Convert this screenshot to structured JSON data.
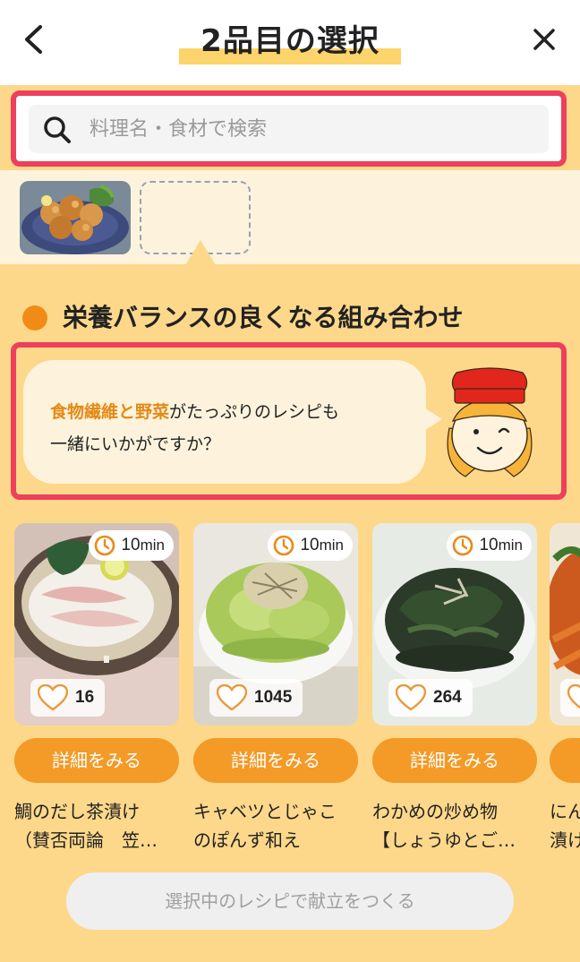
{
  "header": {
    "title": "2品目の選択",
    "back_icon": "chevron-left-icon",
    "close_icon": "close-icon"
  },
  "search": {
    "placeholder": "料理名・食材で検索",
    "value": "",
    "icon": "search-icon"
  },
  "selection": {
    "slots": [
      {
        "state": "filled",
        "image": "fried-chicken-photo"
      },
      {
        "state": "empty"
      }
    ]
  },
  "section": {
    "title": "栄養バランスの良くなる組み合わせ"
  },
  "advice": {
    "highlight1": "食物繊維",
    "connector": "と",
    "highlight2": "野菜",
    "rest_line1": "がたっぷりのレシピも",
    "line2": "一緒にいかがですか？"
  },
  "recipes": [
    {
      "time_value": "10",
      "time_unit": "min",
      "likes": "16",
      "detail_label": "詳細をみる",
      "name": "鯛のだし茶漬け\n（賛否両論　笠…"
    },
    {
      "time_value": "10",
      "time_unit": "min",
      "likes": "1045",
      "detail_label": "詳細をみる",
      "name": "キャベツとじゃこ\nのぽんず和え"
    },
    {
      "time_value": "10",
      "time_unit": "min",
      "likes": "264",
      "detail_label": "詳細をみる",
      "name": "わかめの炒め物\n【しょうゆとご…"
    },
    {
      "time_value": "",
      "time_unit": "",
      "likes": "",
      "detail_label": "",
      "name": "にん\n漬け"
    }
  ],
  "footer": {
    "create_label": "選択中のレシピで献立をつくる"
  },
  "colors": {
    "accent_orange": "#f39a27",
    "highlight_red": "#ee3f5c",
    "background_yellow": "#fdd88a",
    "pale_cream": "#fdf3dc"
  }
}
